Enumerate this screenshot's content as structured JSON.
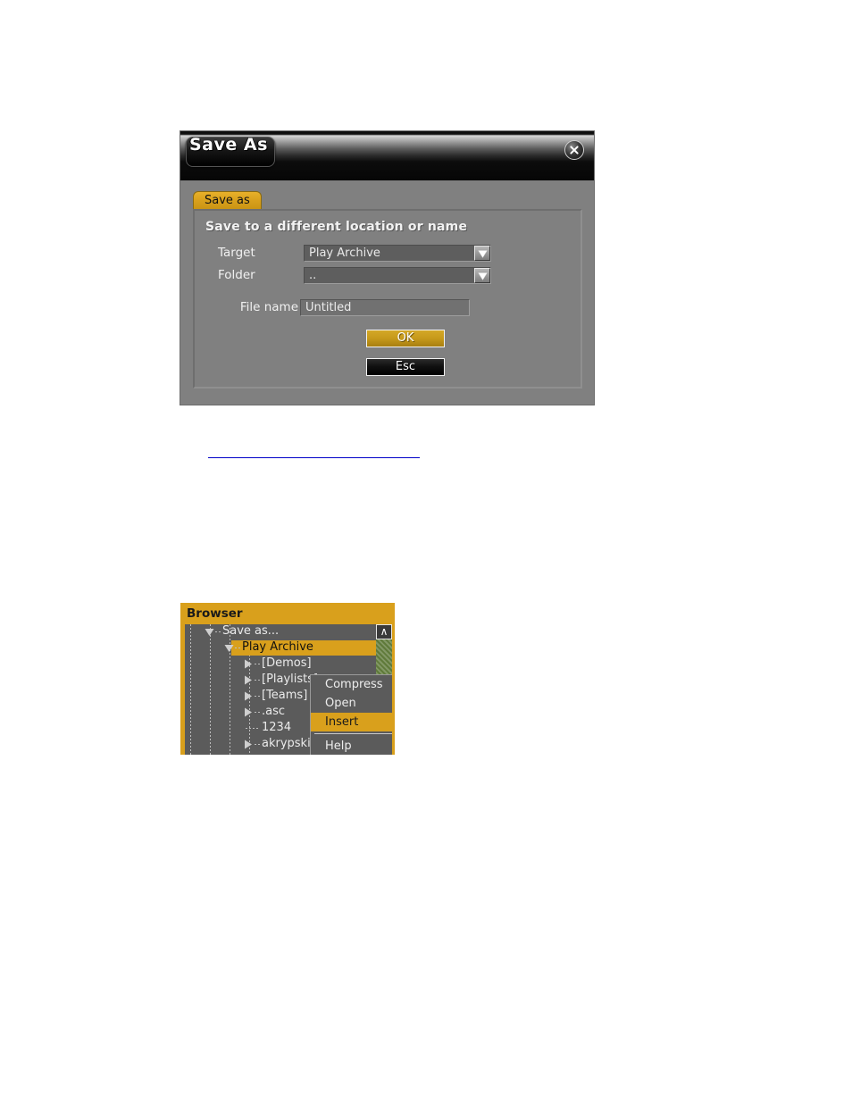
{
  "dialog": {
    "title": "Save As",
    "close_icon": "close-circle-icon",
    "tab": {
      "label": "Save as"
    },
    "panel": {
      "heading": "Save to a different location or name",
      "fields": [
        {
          "label": "Target",
          "type": "combo",
          "value": "Play Archive",
          "arrow_icon": "chevron-down-icon"
        },
        {
          "label": "Folder",
          "type": "combo",
          "value": "..",
          "arrow_icon": "chevron-down-icon"
        },
        {
          "label": "File name",
          "type": "text",
          "value": "Untitled",
          "placeholder": "Untitled"
        }
      ],
      "buttons": [
        {
          "label": "OK",
          "name": "ok-button",
          "color": "#c79a1b"
        },
        {
          "label": "Esc",
          "name": "esc-button",
          "color": "#111111"
        }
      ]
    }
  },
  "doc_link": {
    "text": ""
  },
  "browser": {
    "title": "Browser",
    "scroll_up_label": "∧",
    "tree": [
      {
        "twisty": "down",
        "label": "Save as...",
        "indent": 28,
        "selected": false
      },
      {
        "twisty": "down",
        "label": "Play Archive",
        "indent": 50,
        "selected": true
      },
      {
        "twisty": "right",
        "label": "[Demos]",
        "indent": 72,
        "selected": false
      },
      {
        "twisty": "right",
        "label": "[Playlists]",
        "indent": 72,
        "selected": false
      },
      {
        "twisty": "right",
        "label": "[Teams]",
        "indent": 72,
        "selected": false
      },
      {
        "twisty": "right",
        "label": ".asc",
        "indent": 72,
        "selected": false
      },
      {
        "twisty": "leaf",
        "label": "1234",
        "indent": 72,
        "selected": false
      },
      {
        "twisty": "right",
        "label": "akrypski_wlf_fc",
        "indent": 72,
        "selected": false
      }
    ],
    "context_menu": {
      "items": [
        {
          "label": "Compress",
          "highlight": false,
          "separator_after": false
        },
        {
          "label": "Open",
          "highlight": false,
          "separator_after": false
        },
        {
          "label": "Insert",
          "highlight": true,
          "separator_after": true
        },
        {
          "label": "Help",
          "highlight": false,
          "separator_after": false
        }
      ]
    }
  },
  "colors": {
    "accent_gold": "#d9a01c",
    "panel_gray": "#808080",
    "tree_gray": "#5b5b5b",
    "link_blue": "#0000c8",
    "scroll_green": "#5f7a3a"
  }
}
